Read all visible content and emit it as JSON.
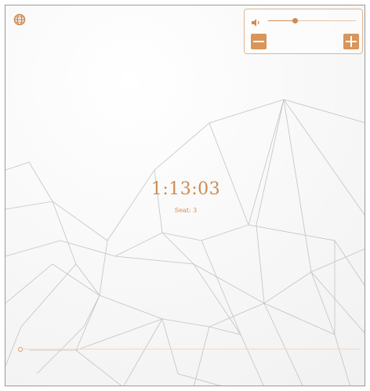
{
  "timer": {
    "time": "1:13:03",
    "seat": "Seat: 3"
  },
  "volume": {
    "icon": "speaker-icon",
    "level": 0.3
  },
  "controls": {
    "minus_icon": "minus-icon",
    "plus_icon": "plus-icon"
  },
  "language": {
    "icon": "globe-icon"
  },
  "progress": {
    "value": 0
  },
  "colors": {
    "accent": "#cf8a52",
    "button": "#d9955a",
    "panel_border": "#e2b48f",
    "background": "#f5f5f5"
  }
}
